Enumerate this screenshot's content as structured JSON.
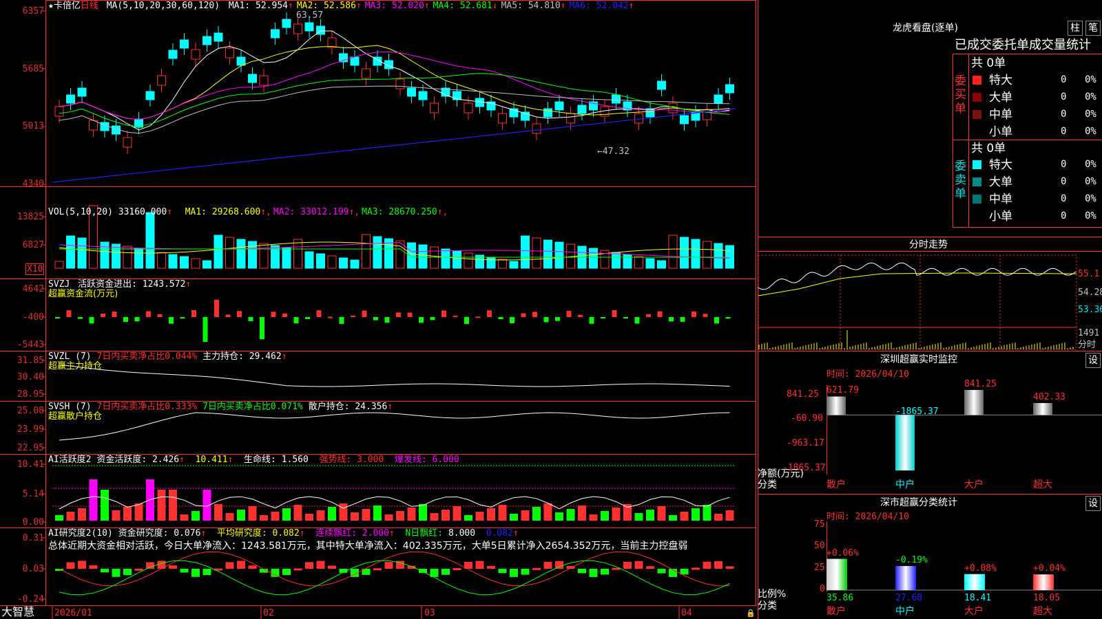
{
  "stock": {
    "name": "卡倍亿",
    "period": "日线"
  },
  "main": {
    "ma_title": "MA(5,10,20,30,60,120)",
    "ma": [
      {
        "label": "MA1:",
        "value": "52.954",
        "arrow": "↑",
        "color": "#ffffff"
      },
      {
        "label": "MA2:",
        "value": "52.586",
        "arrow": "↑",
        "color": "#ffff00"
      },
      {
        "label": "MA3:",
        "value": "52.020",
        "arrow": "↑",
        "color": "#ff00ff"
      },
      {
        "label": "MA4:",
        "value": "52.681",
        "arrow": "↓",
        "color": "#00ff00"
      },
      {
        "label": "MA5:",
        "value": "54.810",
        "arrow": "↑",
        "color": "#c0c0c0"
      },
      {
        "label": "MA6:",
        "value": "52.042",
        "arrow": "↑",
        "color": "#2020ff"
      }
    ],
    "y_ticks": [
      "6357",
      "5685",
      "5013",
      "4340"
    ],
    "high_label": "63.57",
    "low_label": "←47.32"
  },
  "vol": {
    "title": "VOL(5,10,20)",
    "value": "33160.000",
    "ma": [
      {
        "label": "MA1:",
        "value": "29268.600",
        "color": "#ffff00"
      },
      {
        "label": "MA2:",
        "value": "33012.199",
        "color": "#ff00ff"
      },
      {
        "label": "MA3:",
        "value": "28670.250",
        "color": "#00ff00"
      }
    ],
    "y_ticks": [
      "13825",
      "6827"
    ],
    "unit": "X10"
  },
  "svzj": {
    "title": "SVZJ",
    "line1_label": "活跃资金进出:",
    "line1_value": "1243.572",
    "line2": "超赢资金流(万元)",
    "y_ticks": [
      "4642",
      "-400",
      "-5443"
    ]
  },
  "svzl": {
    "title": "SVZL (7)",
    "seg1": "7日内买卖净占比0.044%",
    "seg2_label": "主力持仓:",
    "seg2_value": "29.462",
    "line2": "超赢主力持仓",
    "y_ticks": [
      "31.85",
      "30.40",
      "28.95"
    ]
  },
  "svsh": {
    "title": "SVSH (7)",
    "seg1": "7日内买卖净占比0.333%",
    "seg2": "7日内买卖净占比0.071%",
    "seg3_label": "散户持仓:",
    "seg3_value": "24.356",
    "line2": "超赢散户持仓",
    "y_ticks": [
      "25.08",
      "23.99",
      "22.95"
    ]
  },
  "ai1": {
    "title": "AI活跃度2",
    "s1_label": "资金活跃度:",
    "s1_value": "2.426",
    "s2_value": "10.411",
    "s3_label": "生命线:",
    "s3_value": "1.560",
    "s4": "强势线: 3.000",
    "s5": "爆发线: 6.000",
    "y_ticks": [
      "10.41",
      "5.14",
      "0.00"
    ]
  },
  "ai2": {
    "title": "AI研究度2(10)",
    "s1_label": "资金研究度:",
    "s1_value": "0.076",
    "s2": "平均研究度: 0.082",
    "s3": "连续飘红: 2.000",
    "s4_label": "N日飘红:",
    "s4_value": "8.000",
    "s5": "0.082",
    "summary": "总体近期大资金相对活跃，今日大单净流入：1243.581万元，其中特大单净流入：402.335万元，大单5日累计净入2654.352万元，当前主力控盘弱",
    "y_ticks": [
      "0.31",
      "0.03",
      "-0.24"
    ]
  },
  "bottom": {
    "brand": "大智慧",
    "months": [
      "2026/01",
      "02",
      "03",
      "04"
    ]
  },
  "lhb": {
    "title": "龙虎看盘(逐单)",
    "btn1": "柱",
    "btn2": "笔",
    "header": "已成交委托单成交量统计",
    "buy_label": "委买单",
    "sell_label": "委卖单",
    "buy_total": "共 0单",
    "sell_total": "共 0单",
    "rows": [
      {
        "name": "特大",
        "count": "0",
        "pct": "0%"
      },
      {
        "name": "大单",
        "count": "0",
        "pct": "0%"
      },
      {
        "name": "中单",
        "count": "0",
        "pct": "0%"
      },
      {
        "name": "小单",
        "count": "0",
        "pct": "0%"
      }
    ],
    "sell_rows": [
      {
        "name": "特大",
        "count": "0",
        "pct": "0%"
      },
      {
        "name": "大单",
        "count": "0",
        "pct": "0%"
      },
      {
        "name": "中单",
        "count": "0",
        "pct": "0%"
      },
      {
        "name": "小单",
        "count": "0",
        "pct": "0%"
      }
    ]
  },
  "intraday": {
    "title": "分时走势",
    "prices": [
      "55.1",
      "54.28",
      "53.36"
    ],
    "vol_top": "1491",
    "vol_unit": "分时"
  },
  "monitor": {
    "title": "深圳超赢实时监控",
    "settings": "设",
    "time": "时间: 2026/04/10",
    "y_ticks": [
      "841.25",
      "-60.90",
      "-963.17",
      "-1865.37"
    ],
    "y_label1": "净额(万元)",
    "y_label2": "分类",
    "values": [
      621.79,
      -1865.37,
      841.25,
      402.33
    ],
    "value_labels": [
      "621.79",
      "-1865.37",
      "841.25",
      "402.33"
    ],
    "categories": [
      "散户",
      "中户",
      "大户",
      "超大"
    ]
  },
  "classify": {
    "title": "深市超赢分类统计",
    "settings": "设",
    "time": "时间: 2026/04/10",
    "y_ticks": [
      "75",
      "50",
      "25",
      "0"
    ],
    "y_label1": "比例%",
    "y_label2": "分类",
    "values": [
      35.86,
      27.68,
      18.41,
      18.05
    ],
    "value_labels": [
      "35.86",
      "27.68",
      "18.41",
      "18.05"
    ],
    "changes": [
      "+0.06%",
      "-0.19%",
      "+0.08%",
      "+0.04%"
    ],
    "categories": [
      "散户",
      "中户",
      "大户",
      "超大"
    ]
  }
}
